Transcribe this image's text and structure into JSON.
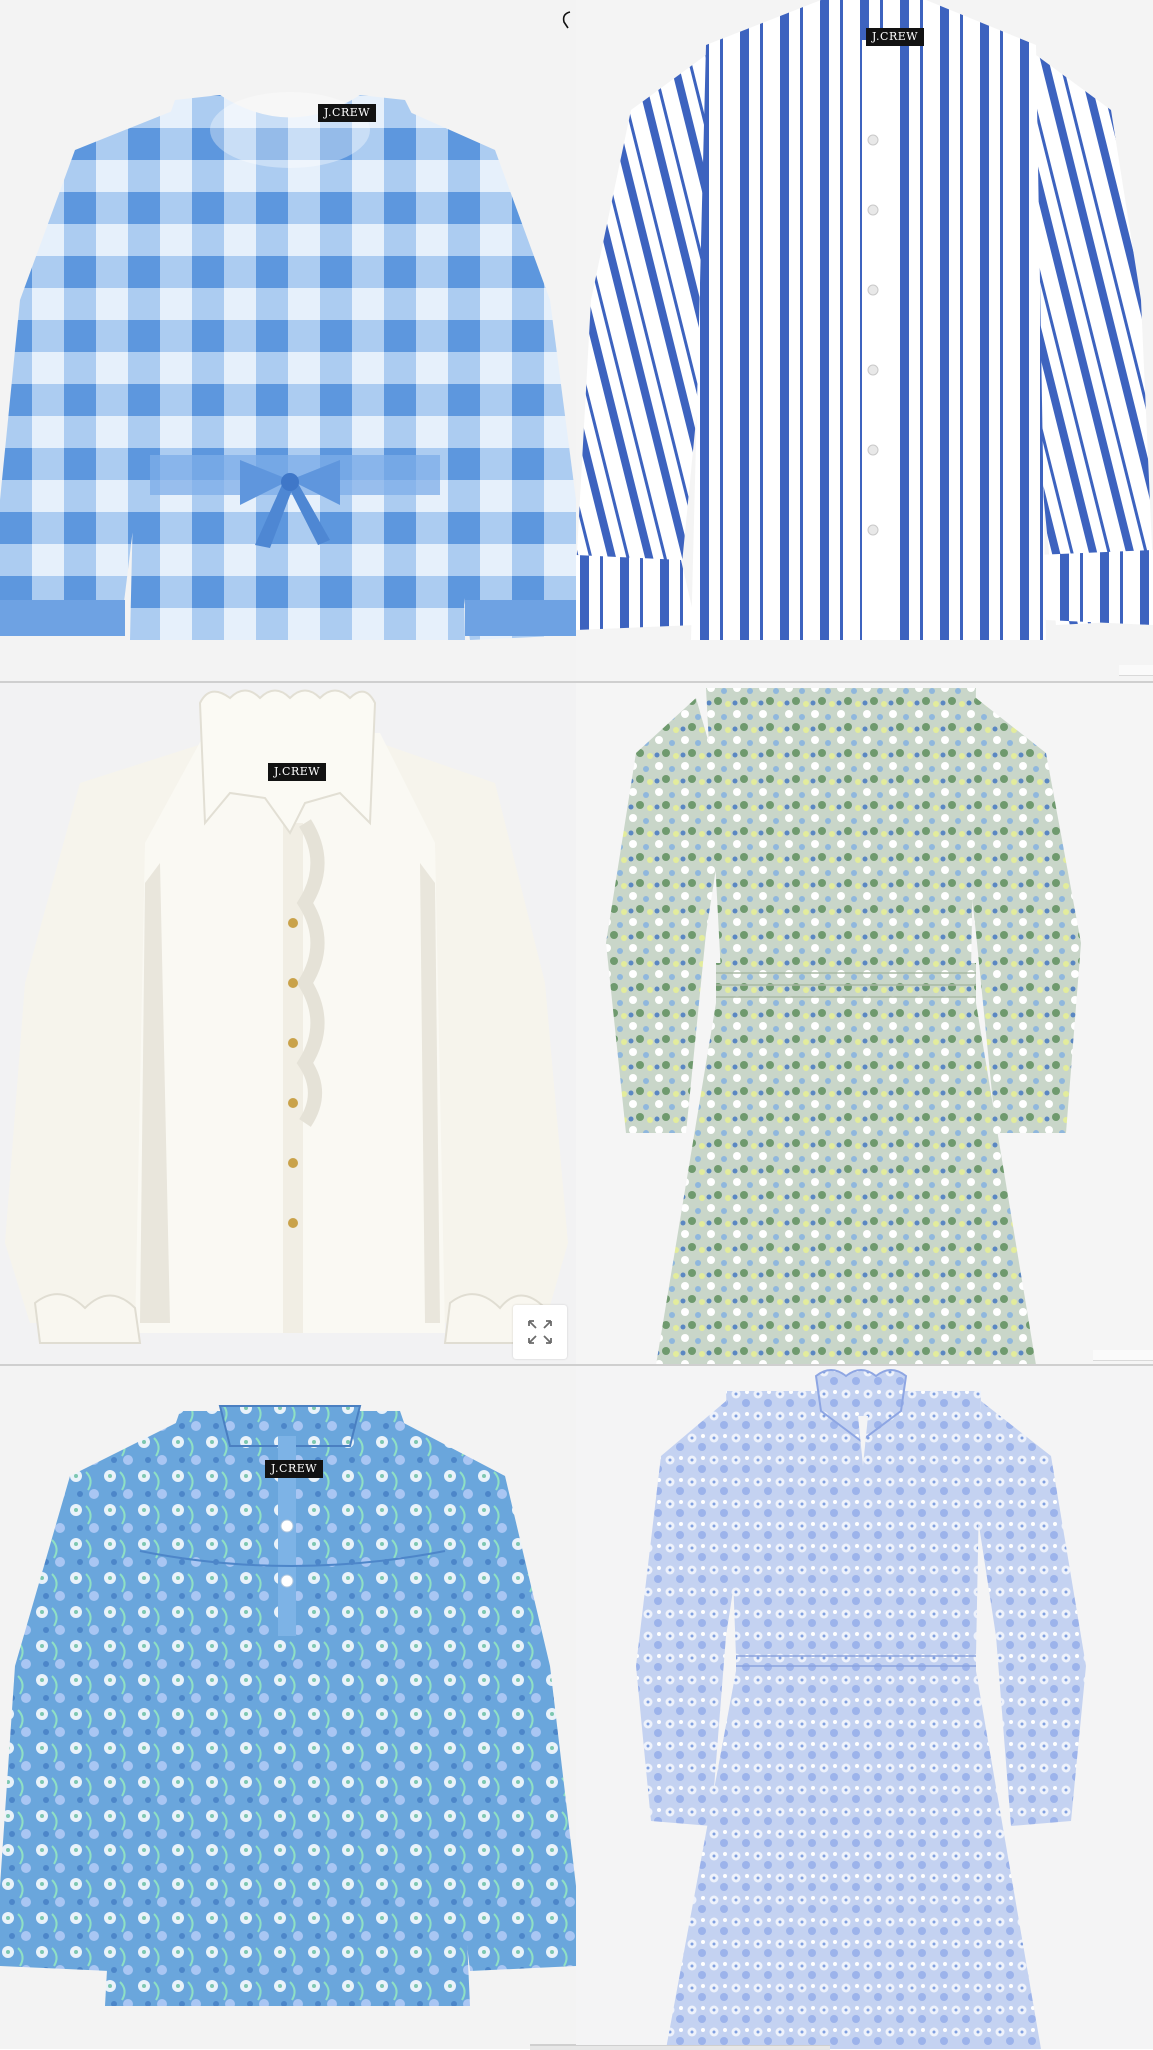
{
  "products": [
    {
      "brand": "J.CREW",
      "item": "gingham tie-waist top"
    },
    {
      "brand": "J.CREW",
      "item": "striped button-up shirt"
    },
    {
      "brand": "J.CREW",
      "item": "ruffle-neck white blouse"
    },
    {
      "brand": "",
      "item": "floral smocked dress"
    },
    {
      "brand": "J.CREW",
      "item": "floral popover top"
    },
    {
      "brand": "",
      "item": "blue floral dress"
    }
  ],
  "icons": {
    "expand": "expand-icon",
    "cursor": "cursor-icon"
  },
  "colors": {
    "gingham_dark": "#6fa4e3",
    "gingham_light": "#c7dcf6",
    "stripe_blue": "#3e66c0",
    "ivory": "#f8f6ef",
    "floral_green": "#b8c9b4",
    "floral_blue": "#6bb0d8",
    "dress_blue": "#b7c8ee",
    "background": "#f1f1f2"
  }
}
